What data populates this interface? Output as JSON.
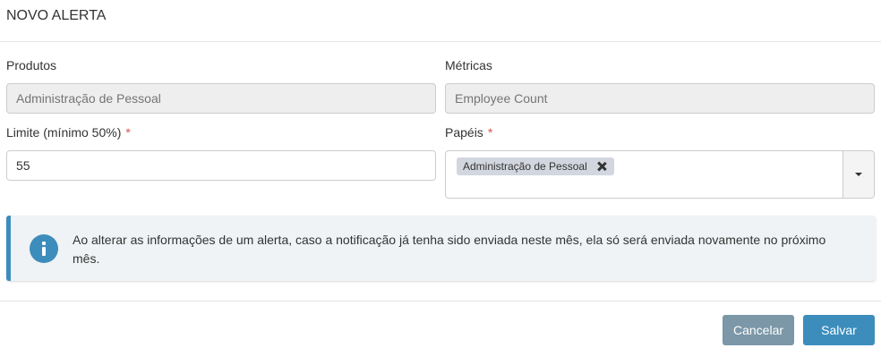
{
  "modal": {
    "title": "NOVO ALERTA"
  },
  "fields": {
    "produtos": {
      "label": "Produtos",
      "placeholder": "Administração de Pessoal"
    },
    "metricas": {
      "label": "Métricas",
      "placeholder": "Employee Count"
    },
    "limite": {
      "label": "Limite (mínimo 50%)",
      "required_mark": "*",
      "value": "55"
    },
    "papeis": {
      "label": "Papéis",
      "required_mark": "*",
      "selected": [
        "Administração de Pessoal"
      ]
    }
  },
  "callout": {
    "icon": "info-icon",
    "text": "Ao alterar as informações de um alerta, caso a notificação já tenha sido enviada neste mês, ela só será enviada novamente no próximo mês."
  },
  "buttons": {
    "cancel": "Cancelar",
    "save": "Salvar"
  },
  "colors": {
    "primary": "#3c8dbc",
    "secondary": "#7b97a8",
    "required": "#d9534f",
    "callout_bg": "#eff3f5"
  }
}
